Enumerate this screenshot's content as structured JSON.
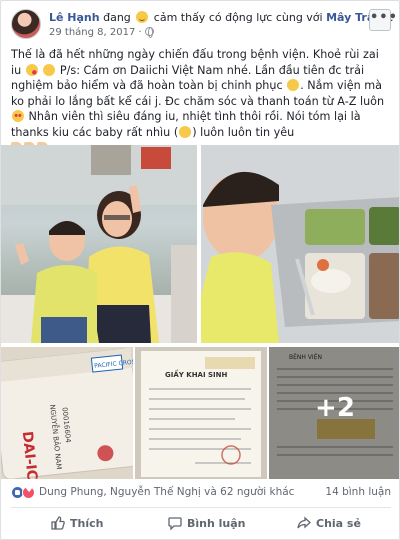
{
  "post": {
    "author": "Lê Hạnh",
    "feeling_prefix": "đang",
    "feeling_text": "cảm thấy có động lực cùng với",
    "tagged": "Mây Trắng",
    "tagged_suffix": ".",
    "date": "29 tháng 8, 2017 ·",
    "more_label": "•••",
    "text": [
      "Thế là đã hết những ngày chiến đấu trong bệnh viện. Khoẻ rùi zai iu ",
      " P/s: Cám ơn Daiichi Việt Nam nhé. Lần đầu tiên đc trải nghiệm bảo hiểm và đã hoàn toàn bị chinh phục ",
      ". Nắm viện mà ko phải lo lắng bất kể cái j. Đc chăm sóc và thanh toán từ A-Z luôn ",
      " Nhân viên thì siêu đáng iu, nhiệt tình thôi rồi. Nói tóm lại là thanks kiu các baby rất nhìu ",
      ") luôn luôn tin yêu"
    ],
    "paren_open": "(",
    "more_photos": "+2",
    "photo_texts": {
      "card_brand": "DAI-ICHI LIFE",
      "card_logo": "PACIFIC CROSS",
      "card_name": "NGUYỄN BẢO NAM",
      "card_number": "00016604",
      "doc_title": "GIẤY KHAI SINH",
      "doc_header": "BỆNH VIỆN"
    }
  },
  "reactions": {
    "names": "Dung Phung, Nguyễn Thế Nghị và 62 người khác",
    "comments": "14 bình luận"
  },
  "actions": {
    "like": "Thích",
    "comment": "Bình luận",
    "share": "Chia sẻ"
  },
  "icons": [
    "avatar",
    "smiley-icon",
    "globe-icon",
    "kiss-emoji-icon",
    "heart-eyes-emoji-icon",
    "thumbs-up-icon",
    "like-reaction-icon",
    "love-reaction-icon",
    "like-icon",
    "comment-icon",
    "share-icon"
  ]
}
